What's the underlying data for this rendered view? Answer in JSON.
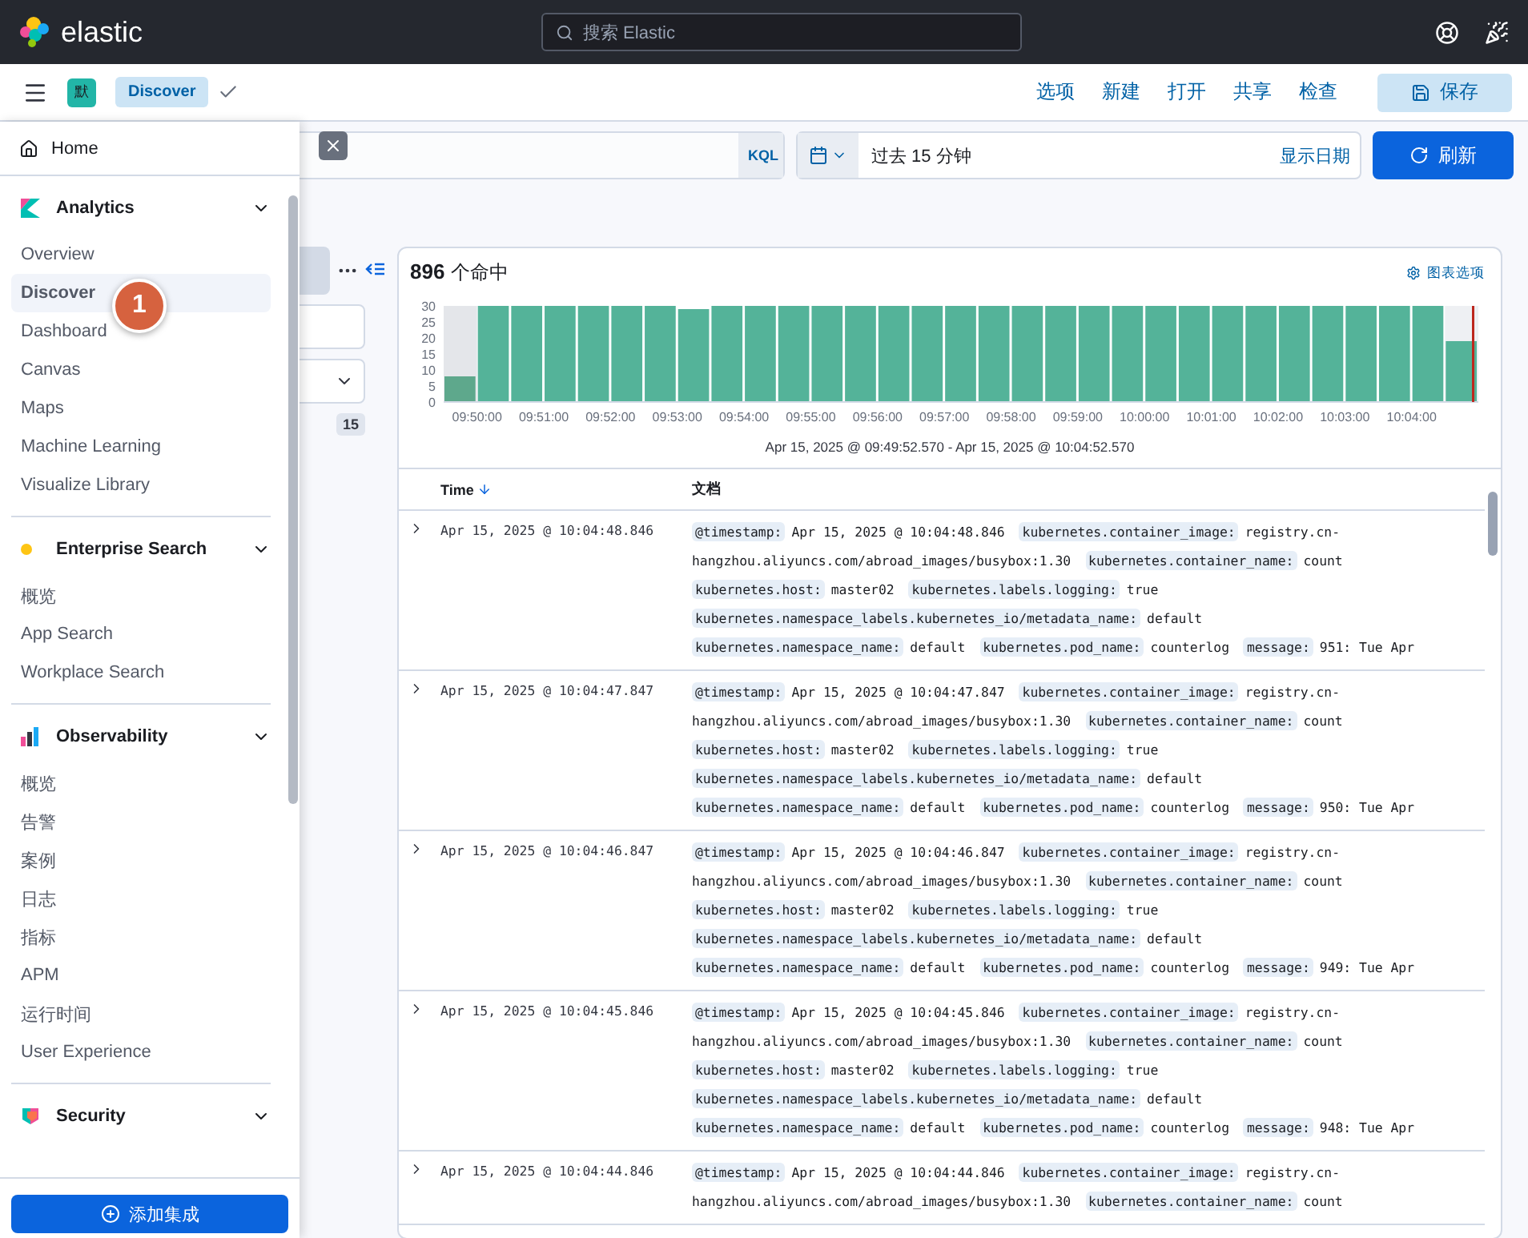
{
  "top_bar": {
    "logo": "elastic",
    "search": {
      "placeholder": "搜索 Elastic"
    }
  },
  "app_bar": {
    "space_badge": "默",
    "breadcrumb": "Discover",
    "menu": [
      "选项",
      "新建",
      "打开",
      "共享",
      "检查"
    ],
    "save_button": "保存"
  },
  "query_bar": {
    "language": "KQL",
    "time_range": "过去 15 分钟",
    "show_dates": "显示日期",
    "refresh_button": "刷新"
  },
  "field_sidebar": {
    "count_badge": "15"
  },
  "nav": {
    "home": "Home",
    "groups": [
      {
        "title": "Analytics",
        "kind": "analytics",
        "expanded": true,
        "items": [
          {
            "label": "Overview",
            "selected": false
          },
          {
            "label": "Discover",
            "selected": true
          },
          {
            "label": "Dashboard",
            "selected": false
          },
          {
            "label": "Canvas",
            "selected": false
          },
          {
            "label": "Maps",
            "selected": false
          },
          {
            "label": "Machine Learning",
            "selected": false
          },
          {
            "label": "Visualize Library",
            "selected": false
          }
        ]
      },
      {
        "title": "Enterprise Search",
        "kind": "enterprise",
        "expanded": true,
        "items": [
          {
            "label": "概览",
            "selected": false
          },
          {
            "label": "App Search",
            "selected": false
          },
          {
            "label": "Workplace Search",
            "selected": false
          }
        ]
      },
      {
        "title": "Observability",
        "kind": "observability",
        "expanded": true,
        "items": [
          {
            "label": "概览",
            "selected": false
          },
          {
            "label": "告警",
            "selected": false
          },
          {
            "label": "案例",
            "selected": false
          },
          {
            "label": "日志",
            "selected": false
          },
          {
            "label": "指标",
            "selected": false
          },
          {
            "label": "APM",
            "selected": false
          },
          {
            "label": "运行时间",
            "selected": false
          },
          {
            "label": "User Experience",
            "selected": false
          }
        ]
      },
      {
        "title": "Security",
        "kind": "security",
        "expanded": true
      }
    ],
    "add_button": "添加集成"
  },
  "callout": "1",
  "results": {
    "hits_count": "896",
    "hits_label": "个命中",
    "chart_options": "图表选项",
    "chart_data": {
      "type": "bar",
      "categories": [
        null,
        "09:50:00",
        null,
        "09:51:00",
        null,
        "09:52:00",
        null,
        "09:53:00",
        null,
        "09:54:00",
        null,
        "09:55:00",
        null,
        "09:56:00",
        null,
        "09:57:00",
        null,
        "09:58:00",
        null,
        "09:59:00",
        null,
        "10:00:00",
        null,
        "10:01:00",
        null,
        "10:02:00",
        null,
        "10:03:00",
        null,
        "10:04:00",
        null
      ],
      "values": [
        8,
        30,
        30,
        30,
        30,
        30,
        30,
        29,
        30,
        30,
        30,
        30,
        30,
        30,
        30,
        30,
        30,
        30,
        30,
        30,
        30,
        30,
        30,
        30,
        30,
        30,
        30,
        30,
        30,
        30,
        19
      ],
      "ylim": [
        0,
        30
      ],
      "yticks": [
        0,
        5,
        10,
        15,
        20,
        25,
        30
      ]
    },
    "time_range_label": "Apr 15, 2025 @ 09:49:52.570 - Apr 15, 2025 @ 10:04:52.570",
    "columns": [
      {
        "label": "Time",
        "sorted": true
      },
      {
        "label": "文档",
        "sorted": false
      }
    ],
    "rows": [
      {
        "time": "Apr 15, 2025 @ 10:04:48.846",
        "fields": [
          {
            "key": "@timestamp:",
            "value": "Apr 15, 2025 @ 10:04:48.846"
          },
          {
            "key": "kubernetes.container_image:",
            "value": "registry.cn-hangzhou.aliyuncs.com/abroad_images/busybox:1.30"
          },
          {
            "key": "kubernetes.container_name:",
            "value": "count"
          },
          {
            "key": "kubernetes.host:",
            "value": "master02"
          },
          {
            "key": "kubernetes.labels.logging:",
            "value": "true"
          },
          {
            "key": "kubernetes.namespace_labels.kubernetes_io/metadata_name:",
            "value": "default"
          },
          {
            "key": "kubernetes.namespace_name:",
            "value": "default"
          },
          {
            "key": "kubernetes.pod_name:",
            "value": "counterlog"
          },
          {
            "key": "message:",
            "value": "951: Tue Apr"
          }
        ]
      },
      {
        "time": "Apr 15, 2025 @ 10:04:47.847",
        "fields": [
          {
            "key": "@timestamp:",
            "value": "Apr 15, 2025 @ 10:04:47.847"
          },
          {
            "key": "kubernetes.container_image:",
            "value": "registry.cn-hangzhou.aliyuncs.com/abroad_images/busybox:1.30"
          },
          {
            "key": "kubernetes.container_name:",
            "value": "count"
          },
          {
            "key": "kubernetes.host:",
            "value": "master02"
          },
          {
            "key": "kubernetes.labels.logging:",
            "value": "true"
          },
          {
            "key": "kubernetes.namespace_labels.kubernetes_io/metadata_name:",
            "value": "default"
          },
          {
            "key": "kubernetes.namespace_name:",
            "value": "default"
          },
          {
            "key": "kubernetes.pod_name:",
            "value": "counterlog"
          },
          {
            "key": "message:",
            "value": "950: Tue Apr"
          }
        ]
      },
      {
        "time": "Apr 15, 2025 @ 10:04:46.847",
        "fields": [
          {
            "key": "@timestamp:",
            "value": "Apr 15, 2025 @ 10:04:46.847"
          },
          {
            "key": "kubernetes.container_image:",
            "value": "registry.cn-hangzhou.aliyuncs.com/abroad_images/busybox:1.30"
          },
          {
            "key": "kubernetes.container_name:",
            "value": "count"
          },
          {
            "key": "kubernetes.host:",
            "value": "master02"
          },
          {
            "key": "kubernetes.labels.logging:",
            "value": "true"
          },
          {
            "key": "kubernetes.namespace_labels.kubernetes_io/metadata_name:",
            "value": "default"
          },
          {
            "key": "kubernetes.namespace_name:",
            "value": "default"
          },
          {
            "key": "kubernetes.pod_name:",
            "value": "counterlog"
          },
          {
            "key": "message:",
            "value": "949: Tue Apr"
          }
        ]
      },
      {
        "time": "Apr 15, 2025 @ 10:04:45.846",
        "fields": [
          {
            "key": "@timestamp:",
            "value": "Apr 15, 2025 @ 10:04:45.846"
          },
          {
            "key": "kubernetes.container_image:",
            "value": "registry.cn-hangzhou.aliyuncs.com/abroad_images/busybox:1.30"
          },
          {
            "key": "kubernetes.container_name:",
            "value": "count"
          },
          {
            "key": "kubernetes.host:",
            "value": "master02"
          },
          {
            "key": "kubernetes.labels.logging:",
            "value": "true"
          },
          {
            "key": "kubernetes.namespace_labels.kubernetes_io/metadata_name:",
            "value": "default"
          },
          {
            "key": "kubernetes.namespace_name:",
            "value": "default"
          },
          {
            "key": "kubernetes.pod_name:",
            "value": "counterlog"
          },
          {
            "key": "message:",
            "value": "948: Tue Apr"
          }
        ]
      },
      {
        "time": "Apr 15, 2025 @ 10:04:44.846",
        "fields": [
          {
            "key": "@timestamp:",
            "value": "Apr 15, 2025 @ 10:04:44.846"
          },
          {
            "key": "kubernetes.container_image:",
            "value": "registry.cn-hangzhou.aliyuncs.com/abroad_images/busybox:1.30"
          },
          {
            "key": "kubernetes.container_name:",
            "value": "count"
          }
        ]
      }
    ]
  }
}
